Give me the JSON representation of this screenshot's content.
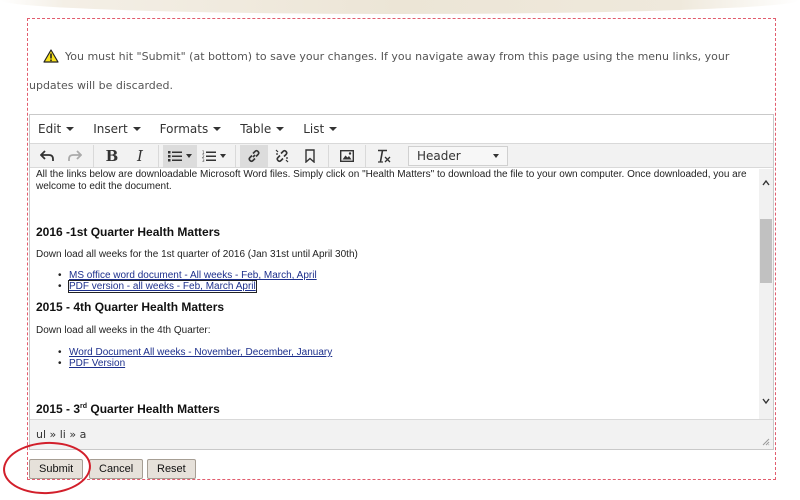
{
  "warning": {
    "text": "You must hit \"Submit\" (at bottom) to save your changes. If you navigate away from this page using the menu links, your updates will be discarded.",
    "icon": "warning-icon"
  },
  "editor": {
    "menubar": [
      "Edit",
      "Insert",
      "Formats",
      "Table",
      "List"
    ],
    "format_select": "Header",
    "statusbar_path": "ul » li » a"
  },
  "content": {
    "intro": "All the links below are downloadable Microsoft Word files. Simply click on \"Health Matters\" to download the file to your own computer. Once downloaded, you are welcome to edit the document.",
    "sections": [
      {
        "heading": "2016 -1st Quarter Health Matters",
        "paragraph": "Down load all weeks for the 1st quarter of 2016 (Jan 31st until April 30th)",
        "links": [
          "MS office word document - All weeks - Feb, March, April",
          "PDF version - all weeks - Feb, March April"
        ]
      },
      {
        "heading": "2015 - 4th Quarter Health Matters",
        "paragraph": "Down load all weeks in the 4th Quarter:",
        "links": [
          "Word Document All weeks - November, December, January",
          "PDF Version"
        ]
      },
      {
        "heading_prefix": "2015 - 3",
        "heading_sup": "rd",
        "heading_suffix": " Quarter Health Matters"
      }
    ]
  },
  "buttons": {
    "submit": "Submit",
    "cancel": "Cancel",
    "reset": "Reset"
  },
  "colors": {
    "panel_border": "#e25d6e",
    "link": "#1c2f8c",
    "highlight_ring": "#d21f2b"
  }
}
